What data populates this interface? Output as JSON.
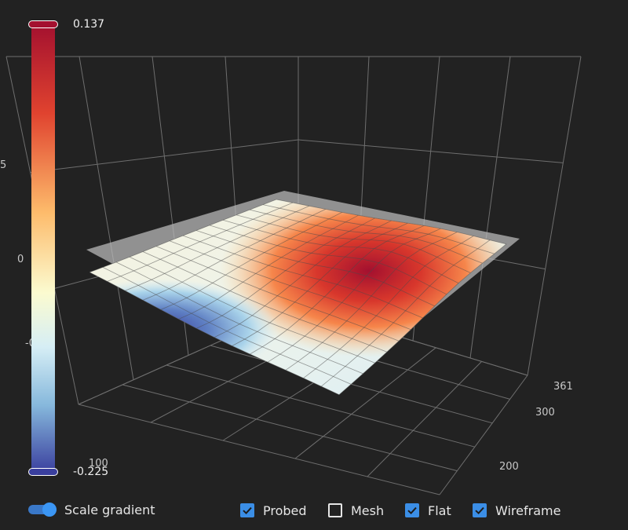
{
  "colors": {
    "background": "#222222",
    "grid": "#6e6e6e",
    "accent": "#3b8ee6",
    "scale_low": "#3a3f9e",
    "scale_mid": "#fbfbd0",
    "scale_high": "#a3102f"
  },
  "colorbar": {
    "max_label": "0.137",
    "min_label": "-0.225",
    "min": -0.225,
    "max": 0.137
  },
  "axis_ticks": {
    "z": [
      "5",
      "0",
      "-0"
    ],
    "x": [
      "100"
    ],
    "y": [
      "200",
      "300",
      "361"
    ]
  },
  "controls": {
    "scale_gradient": {
      "label": "Scale gradient",
      "on": true
    },
    "checkboxes": [
      {
        "id": "probed",
        "label": "Probed",
        "checked": true
      },
      {
        "id": "mesh",
        "label": "Mesh",
        "checked": false
      },
      {
        "id": "flat",
        "label": "Flat",
        "checked": true
      },
      {
        "id": "wireframe",
        "label": "Wireframe",
        "checked": true
      }
    ]
  }
}
